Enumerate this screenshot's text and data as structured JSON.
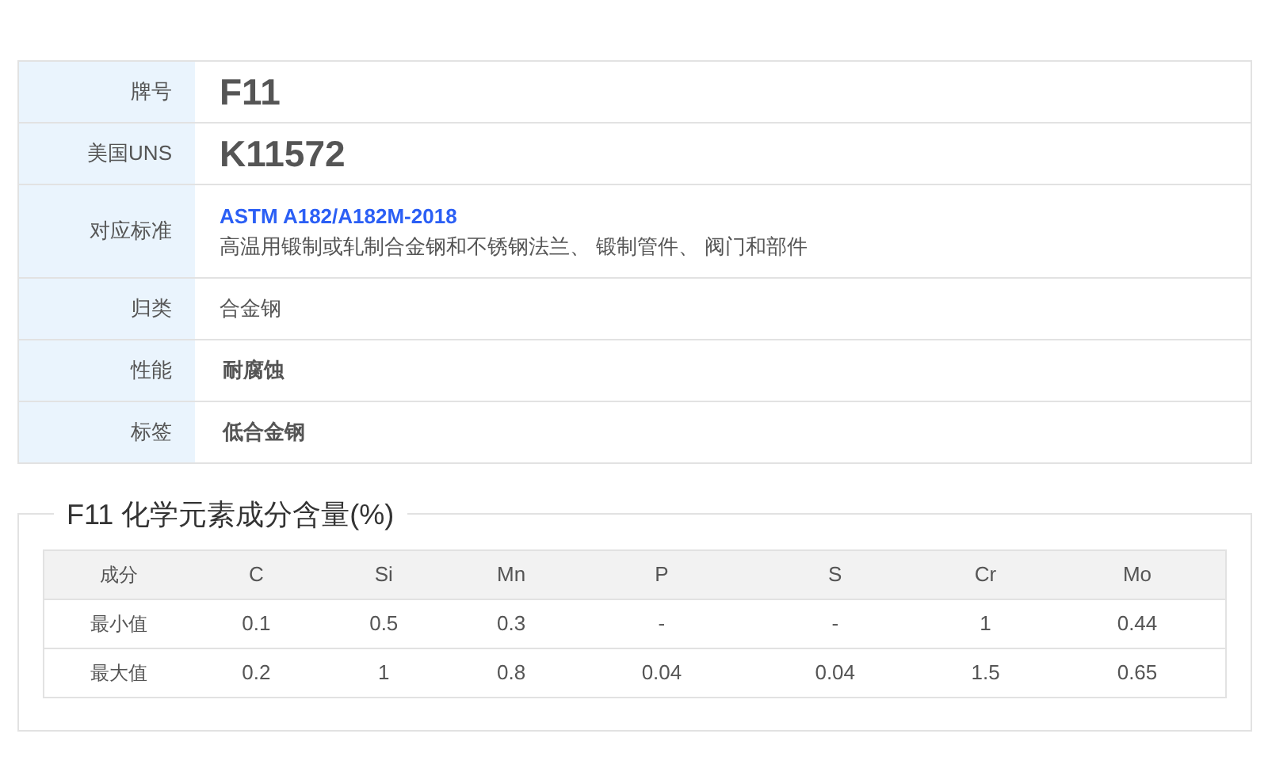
{
  "info": [
    {
      "label": "牌号",
      "kind": "big",
      "value": "F11"
    },
    {
      "label": "美国UNS",
      "kind": "big",
      "value": "K11572"
    },
    {
      "label": "对应标准",
      "kind": "standard",
      "link": "ASTM A182/A182M-2018",
      "value": "高温用锻制或轧制合金钢和不锈钢法兰、 锻制管件、 阀门和部件"
    },
    {
      "label": "归类",
      "kind": "plain",
      "value": "合金钢"
    },
    {
      "label": "性能",
      "kind": "bold",
      "value": "耐腐蚀"
    },
    {
      "label": "标签",
      "kind": "bold",
      "value": "低合金钢"
    }
  ],
  "composition": {
    "title": "F11 化学元素成分含量(%)",
    "columns": [
      "成分",
      "C",
      "Si",
      "Mn",
      "P",
      "S",
      "Cr",
      "Mo"
    ],
    "rows": [
      [
        "最小值",
        "0.1",
        "0.5",
        "0.3",
        "-",
        "-",
        "1",
        "0.44"
      ],
      [
        "最大值",
        "0.2",
        "1",
        "0.8",
        "0.04",
        "0.04",
        "1.5",
        "0.65"
      ]
    ]
  }
}
